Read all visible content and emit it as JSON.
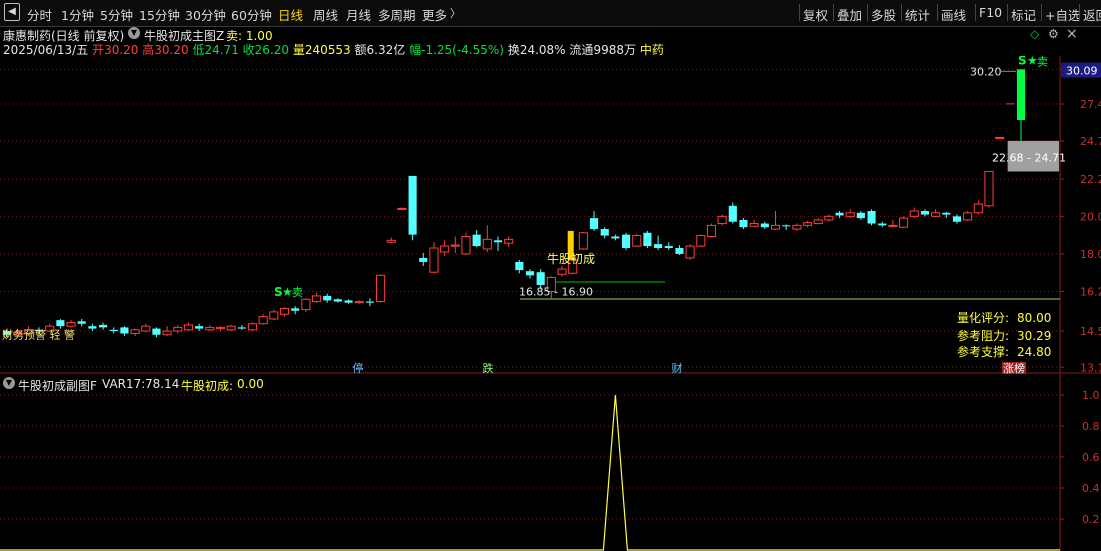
{
  "toolbar": {
    "left_icon": "back-icon",
    "left_items": [
      "分时",
      "1分钟",
      "5分钟",
      "15分钟",
      "30分钟",
      "60分钟",
      "日线",
      "周线",
      "月线",
      "多周期",
      "更多"
    ],
    "active_item": "日线",
    "more_arrow_icon": "chevron-right-icon",
    "right_items": [
      "复权",
      "叠加",
      "多股",
      "统计",
      "画线",
      "F10",
      "标记",
      "+自选",
      "返回"
    ]
  },
  "main": {
    "stock_title": "康惠制药(日线 前复权)",
    "indicator_icon": "dropdown-circle-icon",
    "indicator_name": "牛股初成主图Z",
    "indicator_value": "卖: 1.00",
    "settings_icon": "gear-icon",
    "close_icon": "close-icon",
    "diamond_icon": "diamond-icon",
    "quote": {
      "date": "2025/06/13/五",
      "open_label": "开",
      "open": "30.20",
      "high_label": "高",
      "high": "30.20",
      "low_label": "低",
      "low": "24.71",
      "close_label": "收",
      "close": "26.20",
      "volume_label": "量",
      "volume": "240553",
      "amount_label": "额",
      "amount": "6.32亿",
      "change_label": "幅",
      "change": "-1.25(-4.55%)",
      "turnover_label": "换",
      "turnover": "24.08%",
      "float_label": "流通",
      "float": "9988万",
      "sector": "中药"
    },
    "price_axis": {
      "current_price": "30.09",
      "ticks": [
        "30.2",
        "27.4",
        "24.7",
        "22.2",
        "20.0",
        "18.0",
        "16.2",
        "14.5",
        "13.1"
      ]
    },
    "annotations": {
      "high_label": "30.20",
      "sell_signal": "卖",
      "sell_signal_early": "卖",
      "gap_range": "22.68 - 24.71",
      "low_range": "16.85 - 16.90",
      "pattern_label": "牛股初成",
      "warning_text": "财务预警 轻 警",
      "markers": [
        "停",
        "跌",
        "财",
        "涨榜"
      ]
    },
    "quant": {
      "score_label": "量化评分:",
      "score": "80.00",
      "resistance_label": "参考阻力:",
      "resistance": "30.29",
      "support_label": "参考支撑:",
      "support": "24.80"
    }
  },
  "sub": {
    "indicator_icon": "dropdown-circle-icon",
    "indicator_name": "牛股初成副图F",
    "var_label": "VAR17:",
    "var_value": "78.14",
    "signal_label": "牛股初成:",
    "signal_value": "0.00",
    "ticks": [
      "1.0",
      "0.8",
      "0.6",
      "0.4",
      "0.2"
    ]
  },
  "colors": {
    "up": "#ff3c3c",
    "down": "#54ffff",
    "signal_green": "#00ff40",
    "yellow": "#ffff40",
    "gap_fill": "#a0a0a0",
    "grid": "#7a1a1a",
    "axis_line": "#8a1a1a",
    "price_tag_bg": "#1c1c80"
  },
  "chart_data": {
    "type": "candlestick",
    "title": "康惠制药(日线 前复权)",
    "y_scale": "log",
    "ylim": [
      13.0,
      31.0
    ],
    "y_ticks": [
      30.2,
      27.4,
      24.7,
      22.2,
      20.0,
      18.0,
      16.2,
      14.5,
      13.1
    ],
    "candles": [
      {
        "o": 14.5,
        "c": 14.35,
        "h": 14.6,
        "l": 14.25
      },
      {
        "o": 14.35,
        "c": 14.45,
        "h": 14.6,
        "l": 14.3
      },
      {
        "o": 14.4,
        "c": 14.55,
        "h": 14.7,
        "l": 14.35
      },
      {
        "o": 14.55,
        "c": 14.5,
        "h": 14.65,
        "l": 14.4
      },
      {
        "o": 14.5,
        "c": 14.7,
        "h": 14.8,
        "l": 14.45
      },
      {
        "o": 14.95,
        "c": 14.7,
        "h": 15.0,
        "l": 14.6
      },
      {
        "o": 14.7,
        "c": 14.85,
        "h": 14.95,
        "l": 14.65
      },
      {
        "o": 14.9,
        "c": 14.8,
        "h": 15.0,
        "l": 14.7
      },
      {
        "o": 14.7,
        "c": 14.6,
        "h": 14.8,
        "l": 14.5
      },
      {
        "o": 14.75,
        "c": 14.65,
        "h": 14.85,
        "l": 14.55
      },
      {
        "o": 14.55,
        "c": 14.5,
        "h": 14.65,
        "l": 14.4
      },
      {
        "o": 14.65,
        "c": 14.4,
        "h": 14.7,
        "l": 14.3
      },
      {
        "o": 14.4,
        "c": 14.55,
        "h": 14.6,
        "l": 14.3
      },
      {
        "o": 14.5,
        "c": 14.7,
        "h": 14.8,
        "l": 14.45
      },
      {
        "o": 14.6,
        "c": 14.35,
        "h": 14.65,
        "l": 14.25
      },
      {
        "o": 14.35,
        "c": 14.5,
        "h": 14.7,
        "l": 14.3
      },
      {
        "o": 14.5,
        "c": 14.65,
        "h": 14.75,
        "l": 14.4
      },
      {
        "o": 14.55,
        "c": 14.75,
        "h": 14.85,
        "l": 14.5
      },
      {
        "o": 14.7,
        "c": 14.6,
        "h": 14.8,
        "l": 14.5
      },
      {
        "o": 14.55,
        "c": 14.65,
        "h": 14.75,
        "l": 14.5
      },
      {
        "o": 14.6,
        "c": 14.65,
        "h": 14.7,
        "l": 14.5
      },
      {
        "o": 14.55,
        "c": 14.7,
        "h": 14.75,
        "l": 14.5
      },
      {
        "o": 14.65,
        "c": 14.6,
        "h": 14.75,
        "l": 14.55
      },
      {
        "o": 14.55,
        "c": 14.8,
        "h": 14.85,
        "l": 14.5
      },
      {
        "o": 14.8,
        "c": 15.1,
        "h": 15.2,
        "l": 14.75
      },
      {
        "o": 15.0,
        "c": 15.3,
        "h": 15.4,
        "l": 14.95
      },
      {
        "o": 15.2,
        "c": 15.45,
        "h": 15.5,
        "l": 15.1
      },
      {
        "o": 15.45,
        "c": 15.35,
        "h": 15.55,
        "l": 15.2
      },
      {
        "o": 15.4,
        "c": 15.85,
        "h": 15.9,
        "l": 15.3
      },
      {
        "o": 15.75,
        "c": 16.0,
        "h": 16.15,
        "l": 15.7
      },
      {
        "o": 16.0,
        "c": 15.8,
        "h": 16.1,
        "l": 15.7
      },
      {
        "o": 15.85,
        "c": 15.75,
        "h": 15.9,
        "l": 15.7
      },
      {
        "o": 15.8,
        "c": 15.7,
        "h": 15.85,
        "l": 15.65
      },
      {
        "o": 15.7,
        "c": 15.75,
        "h": 15.8,
        "l": 15.65
      },
      {
        "o": 15.75,
        "c": 15.7,
        "h": 15.9,
        "l": 15.55
      },
      {
        "o": 15.75,
        "c": 16.95,
        "h": 17.0,
        "l": 15.7
      },
      {
        "o": 18.6,
        "c": 18.7,
        "h": 18.85,
        "l": 18.55
      },
      {
        "o": 20.4,
        "c": 20.45,
        "h": 20.5,
        "l": 20.35
      },
      {
        "o": 22.4,
        "c": 19.0,
        "h": 22.4,
        "l": 18.7
      },
      {
        "o": 17.8,
        "c": 17.6,
        "h": 18.05,
        "l": 17.4
      },
      {
        "o": 17.1,
        "c": 18.3,
        "h": 18.6,
        "l": 17.05
      },
      {
        "o": 18.1,
        "c": 18.4,
        "h": 18.7,
        "l": 17.9
      },
      {
        "o": 18.4,
        "c": 18.45,
        "h": 18.9,
        "l": 18.05
      },
      {
        "o": 18.0,
        "c": 18.9,
        "h": 19.1,
        "l": 17.95
      },
      {
        "o": 19.0,
        "c": 18.4,
        "h": 19.25,
        "l": 18.35
      },
      {
        "o": 18.25,
        "c": 18.75,
        "h": 19.5,
        "l": 18.1
      },
      {
        "o": 18.7,
        "c": 18.6,
        "h": 18.9,
        "l": 18.15
      },
      {
        "o": 18.55,
        "c": 18.75,
        "h": 18.9,
        "l": 18.35
      },
      {
        "o": 17.6,
        "c": 17.2,
        "h": 17.7,
        "l": 17.05
      },
      {
        "o": 17.15,
        "c": 16.95,
        "h": 17.25,
        "l": 16.8
      },
      {
        "o": 17.1,
        "c": 16.5,
        "h": 17.25,
        "l": 16.3
      },
      {
        "o": 16.2,
        "c": 16.85,
        "h": 16.9,
        "l": 15.85
      },
      {
        "o": 17.0,
        "c": 17.25,
        "h": 17.4,
        "l": 16.9
      },
      {
        "o": 17.05,
        "c": 17.7,
        "h": 17.75,
        "l": 17.0
      },
      {
        "o": 18.25,
        "c": 19.1,
        "h": 19.15,
        "l": 18.2
      },
      {
        "o": 19.9,
        "c": 19.3,
        "h": 20.3,
        "l": 19.2
      },
      {
        "o": 19.3,
        "c": 18.95,
        "h": 19.4,
        "l": 18.8
      },
      {
        "o": 18.9,
        "c": 18.8,
        "h": 19.0,
        "l": 18.7
      },
      {
        "o": 19.0,
        "c": 18.3,
        "h": 19.1,
        "l": 18.2
      },
      {
        "o": 18.4,
        "c": 18.95,
        "h": 19.05,
        "l": 18.35
      },
      {
        "o": 19.1,
        "c": 18.4,
        "h": 19.2,
        "l": 18.3
      },
      {
        "o": 18.5,
        "c": 18.3,
        "h": 18.95,
        "l": 18.2
      },
      {
        "o": 18.4,
        "c": 18.3,
        "h": 18.6,
        "l": 18.2
      },
      {
        "o": 18.3,
        "c": 18.0,
        "h": 18.45,
        "l": 17.95
      },
      {
        "o": 17.8,
        "c": 18.4,
        "h": 18.5,
        "l": 17.7
      },
      {
        "o": 18.4,
        "c": 18.95,
        "h": 19.0,
        "l": 18.35
      },
      {
        "o": 18.9,
        "c": 19.5,
        "h": 19.6,
        "l": 18.85
      },
      {
        "o": 19.6,
        "c": 20.0,
        "h": 20.1,
        "l": 19.5
      },
      {
        "o": 20.6,
        "c": 19.7,
        "h": 20.8,
        "l": 19.6
      },
      {
        "o": 19.8,
        "c": 19.4,
        "h": 19.9,
        "l": 19.3
      },
      {
        "o": 19.45,
        "c": 19.6,
        "h": 19.8,
        "l": 19.4
      },
      {
        "o": 19.6,
        "c": 19.4,
        "h": 19.7,
        "l": 19.3
      },
      {
        "o": 19.3,
        "c": 19.5,
        "h": 20.3,
        "l": 19.25
      },
      {
        "o": 19.5,
        "c": 19.45,
        "h": 19.55,
        "l": 19.25
      },
      {
        "o": 19.3,
        "c": 19.5,
        "h": 19.6,
        "l": 19.2
      },
      {
        "o": 19.5,
        "c": 19.65,
        "h": 19.75,
        "l": 19.4
      },
      {
        "o": 19.6,
        "c": 19.8,
        "h": 19.9,
        "l": 19.55
      },
      {
        "o": 19.8,
        "c": 20.0,
        "h": 20.1,
        "l": 19.7
      },
      {
        "o": 20.2,
        "c": 20.05,
        "h": 20.3,
        "l": 19.9
      },
      {
        "o": 20.0,
        "c": 20.2,
        "h": 20.4,
        "l": 19.9
      },
      {
        "o": 20.2,
        "c": 19.9,
        "h": 20.3,
        "l": 19.8
      },
      {
        "o": 20.3,
        "c": 19.6,
        "h": 20.4,
        "l": 19.5
      },
      {
        "o": 19.6,
        "c": 19.5,
        "h": 19.7,
        "l": 19.4
      },
      {
        "o": 19.5,
        "c": 19.5,
        "h": 19.8,
        "l": 19.4
      },
      {
        "o": 19.4,
        "c": 19.9,
        "h": 20.0,
        "l": 19.35
      },
      {
        "o": 20.0,
        "c": 20.3,
        "h": 20.5,
        "l": 19.9
      },
      {
        "o": 20.3,
        "c": 20.1,
        "h": 20.4,
        "l": 20.0
      },
      {
        "o": 20.0,
        "c": 20.2,
        "h": 20.4,
        "l": 19.95
      },
      {
        "o": 20.2,
        "c": 20.1,
        "h": 20.25,
        "l": 19.9
      },
      {
        "o": 20.0,
        "c": 19.7,
        "h": 20.1,
        "l": 19.6
      },
      {
        "o": 19.8,
        "c": 20.2,
        "h": 20.3,
        "l": 19.75
      },
      {
        "o": 20.2,
        "c": 20.7,
        "h": 20.9,
        "l": 20.1
      },
      {
        "o": 20.6,
        "c": 22.68,
        "h": 22.68,
        "l": 20.5
      },
      {
        "o": 24.95,
        "c": 24.95,
        "h": 24.95,
        "l": 24.95
      },
      {
        "o": 27.45,
        "c": 27.45,
        "h": 27.45,
        "l": 27.45
      },
      {
        "o": 30.2,
        "c": 26.2,
        "h": 30.2,
        "l": 24.71
      }
    ],
    "sub_series": {
      "name": "牛股初成",
      "peak_index": 57,
      "peak_value": 1.0,
      "base_value": 0.0
    }
  }
}
